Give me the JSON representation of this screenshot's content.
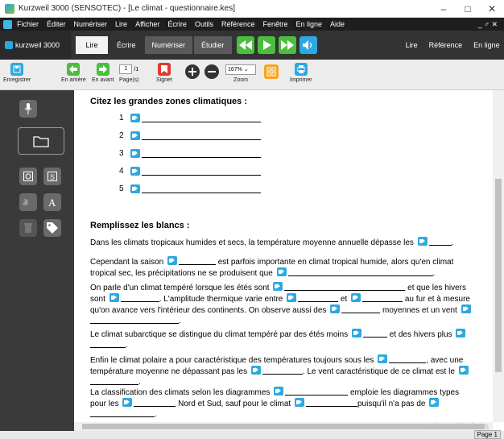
{
  "window": {
    "title": "Kurzweil 3000 (SENSOTEC) - [Le climat - questionnaire.kes]",
    "controls": [
      "–",
      "□",
      "✕"
    ]
  },
  "menu": {
    "items": [
      "Fichier",
      "Éditer",
      "Numériser",
      "Lire",
      "Afficher",
      "Écrire",
      "Outils",
      "Référence",
      "Fenêtre",
      "En ligne",
      "Aide"
    ],
    "right": "_ ♂ ✕"
  },
  "tabs": {
    "logo": "kurzweil 3000",
    "items": [
      "Lire",
      "Écrire",
      "Numériser",
      "Étudier"
    ],
    "right": [
      "Lire",
      "Référence",
      "En ligne"
    ]
  },
  "toolbar": {
    "save": "Enregistrer",
    "back": "En arrière",
    "forward": "En avant",
    "page_value": "1",
    "page_total": "/1",
    "pages": "Page(s)",
    "bookmark": "Signet",
    "zoom_value": "167%",
    "zoom": "Zoom",
    "print": "Imprimer"
  },
  "document": {
    "q1_title": "Citez les grandes zones climatiques :",
    "q1_numbers": [
      "1",
      "2",
      "3",
      "4",
      "5"
    ],
    "q2_title": "Remplissez les blancs :",
    "p1": [
      "Dans les climats tropicaux humides et secs, la température moyenne annuelle dépasse les",
      "."
    ],
    "p2": [
      "Cependant la saison",
      "est parfois importante en climat tropical humide, alors qu'en",
      "climat tropical sec, les précipitations ne se produisent que",
      "."
    ],
    "p3": [
      "On parle d'un climat tempéré lorsque les étés sont",
      "et que les",
      "hivers sont",
      ". L'amplitude thermique varie entre",
      "et",
      "au fur et à mesure qu'on avance vers l'intérieur des continents. On observe aussi des",
      "moyennes et un vent",
      "."
    ],
    "p4": [
      "Le climat subarctique se distingue du climat tempéré par des étés moins",
      "et des hivers plus",
      "."
    ],
    "p5": [
      "Enfin le climat polaire a pour caractéristique des températures toujours sous les",
      ", avec",
      "une température moyenne ne dépassant pas les",
      ". Le vent caractéristique de ce climat",
      "est le",
      "."
    ],
    "p6": [
      "La classification des climats selon les diagrammes",
      "emploie les diagrammes",
      "types pour les",
      "Nord et Sud, sauf pour le climat",
      "puisqu'il n'a pas",
      "de",
      "."
    ]
  },
  "status": {
    "page": "Page 1",
    "watermark": "Activer Windows"
  },
  "colors": {
    "green": "#4dbd3f",
    "blue": "#2ea8e0",
    "red": "#e03a2f",
    "orange": "#f5a623",
    "dark": "#333333"
  }
}
